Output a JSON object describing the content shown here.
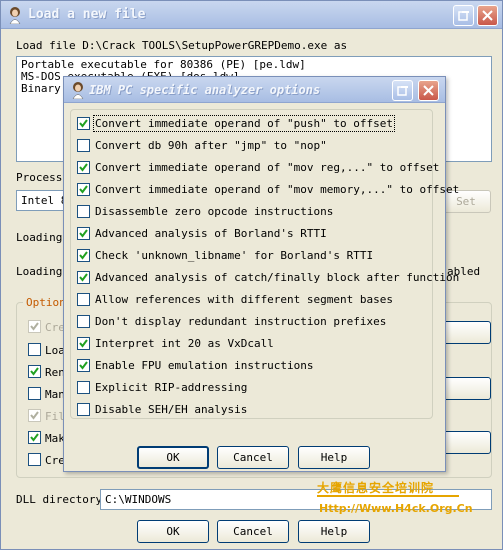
{
  "main_window": {
    "title": "Load a new file",
    "load_file_label": "Load file D:\\Crack TOOLS\\SetupPowerGREPDemo.exe as",
    "file_types": [
      "Portable executable for 80386 (PE) [pe.ldw]",
      "MS-DOS executable (EXE) [dos.ldw]",
      "Binary file"
    ],
    "processor_label": "Processo",
    "processor_value": "Intel 80",
    "set_button": "Set",
    "loading_label_1": "Loading",
    "loading_label_2": "Loading",
    "abled_suffix": "abled",
    "options_group_label": "Option",
    "options": [
      {
        "label": "Cre",
        "checked": true,
        "disabled": true
      },
      {
        "label": "Loa",
        "checked": false,
        "disabled": false
      },
      {
        "label": "Ren",
        "checked": true,
        "disabled": false
      },
      {
        "label": "Man",
        "checked": false,
        "disabled": false
      },
      {
        "label": "Fil",
        "checked": true,
        "disabled": true
      },
      {
        "label": "Mak",
        "checked": true,
        "disabled": false
      },
      {
        "label": "Cre",
        "checked": false,
        "disabled": false
      }
    ],
    "dll_label": "DLL directory",
    "dll_value": "C:\\WINDOWS",
    "ok_button": "OK",
    "cancel_button": "Cancel",
    "help_button": "Help"
  },
  "dialog": {
    "title": "IBM PC specific analyzer options",
    "options": [
      {
        "label": "Convert immediate operand of \"push\" to offset",
        "checked": true
      },
      {
        "label": "Convert db 90h after \"jmp\" to \"nop\"",
        "checked": false
      },
      {
        "label": "Convert immediate operand of \"mov reg,...\" to offset",
        "checked": true
      },
      {
        "label": "Convert immediate operand of \"mov memory,...\" to offset",
        "checked": true
      },
      {
        "label": "Disassemble zero opcode instructions",
        "checked": false
      },
      {
        "label": "Advanced analysis of Borland's RTTI",
        "checked": true
      },
      {
        "label": "Check 'unknown_libname' for Borland's RTTI",
        "checked": true
      },
      {
        "label": "Advanced analysis of catch/finally block after function",
        "checked": true
      },
      {
        "label": "Allow references with different segment bases",
        "checked": false
      },
      {
        "label": "Don't display redundant instruction prefixes",
        "checked": false
      },
      {
        "label": "Interpret int 20 as VxDcall",
        "checked": true
      },
      {
        "label": "Enable FPU emulation instructions",
        "checked": true
      },
      {
        "label": "Explicit RIP-addressing",
        "checked": false
      },
      {
        "label": "Disable SEH/EH analysis",
        "checked": false
      }
    ],
    "ok_button": "OK",
    "cancel_button": "Cancel",
    "help_button": "Help"
  },
  "watermark": {
    "line1": "大鹰信息安全培训院",
    "line2": "Http://Www.H4ck.Org.Cn"
  },
  "colors": {
    "title_gradient_top": "#c9d7ef",
    "window_bg": "#ece9d8",
    "check_green": "#21a121",
    "watermark": "#e6a500"
  }
}
